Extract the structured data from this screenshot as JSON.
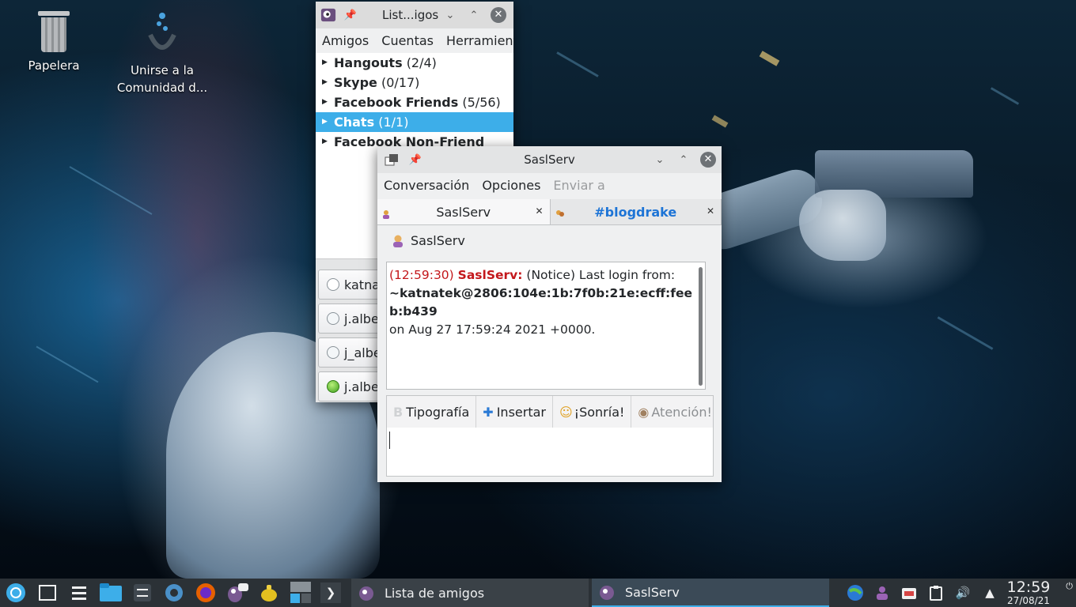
{
  "desktop": {
    "icons": [
      {
        "label": "Papelera"
      },
      {
        "label": "Unirse a la Comunidad d..."
      }
    ]
  },
  "buddy_window": {
    "title": "List...igos",
    "menu": [
      "Amigos",
      "Cuentas",
      "Herramientas"
    ],
    "groups": [
      {
        "name": "Hangouts",
        "count": "(2/4)"
      },
      {
        "name": "Skype",
        "count": "(0/17)"
      },
      {
        "name": "Facebook Friends",
        "count": "(5/56)"
      },
      {
        "name": "Chats",
        "count": "(1/1)"
      },
      {
        "name": "Facebook Non-Friend",
        "count": ""
      }
    ],
    "accounts": [
      {
        "label": "katnatek"
      },
      {
        "label": "j.alberto"
      },
      {
        "label": "j_alberto"
      },
      {
        "label": "j.alberto"
      }
    ]
  },
  "chat_window": {
    "title": "SaslServ",
    "menu": [
      "Conversación",
      "Opciones",
      "Enviar a"
    ],
    "tabs": [
      {
        "label": "SaslServ"
      },
      {
        "label": "#blogdrake"
      }
    ],
    "conversation_name": "SaslServ",
    "log": {
      "timestamp": "(12:59:30)",
      "sender": "SaslServ:",
      "line1": "(Notice) Last login from:",
      "line2": "~katnatek@2806:104e:1b:7f0b:21e:ecff:feeb:b439",
      "line3": "on Aug 27 17:59:24 2021 +0000."
    },
    "toolbar": {
      "font": "Tipografía",
      "insert": "Insertar",
      "smile": "¡Sonría!",
      "attention": "Atención!"
    }
  },
  "taskbar": {
    "tasks": [
      {
        "label": "Lista de amigos"
      },
      {
        "label": "SaslServ"
      }
    ],
    "clock": {
      "time": "12:59",
      "date": "27/08/21"
    }
  },
  "colors": {
    "accent": "#3daee9",
    "log_red": "#c3171b",
    "channel_blue": "#1d74d6",
    "taskbar": "#2b3136"
  }
}
